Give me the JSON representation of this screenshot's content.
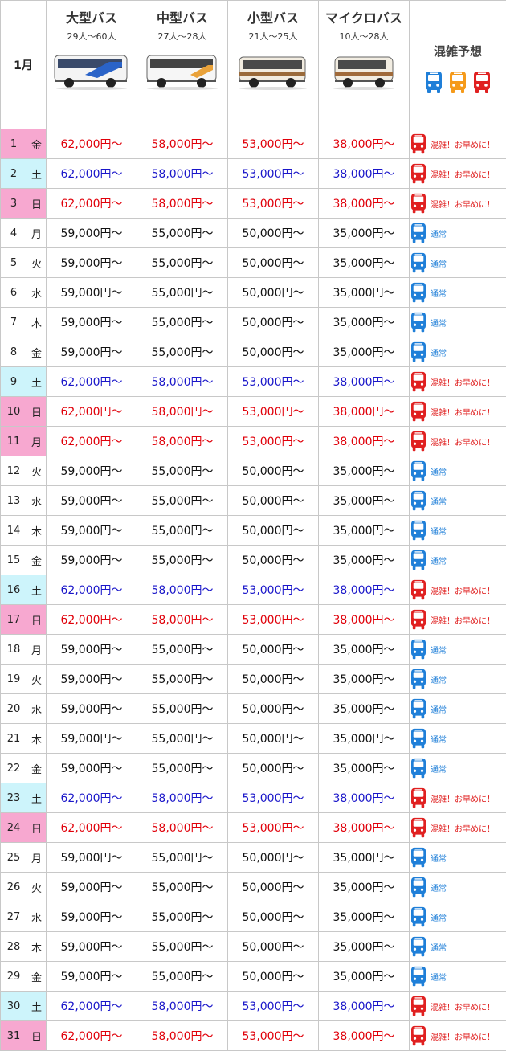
{
  "header": {
    "month": "1月",
    "buses": [
      {
        "name": "大型バス",
        "capacity": "29人～60人"
      },
      {
        "name": "中型バス",
        "capacity": "27人～28人"
      },
      {
        "name": "小型バス",
        "capacity": "21人～25人"
      },
      {
        "name": "マイクロバス",
        "capacity": "10人～28人"
      }
    ],
    "forecast_title": "混雑予想"
  },
  "colors": {
    "red": "#e02020",
    "blue": "#1f7fd8",
    "orange": "#f59a1a",
    "sat_blue": "#1a16c9",
    "sun_pink": "#f7a8d0",
    "sat_cyan": "#cdf4fb"
  },
  "forecast_labels": {
    "busy": "混雑！お早めに！",
    "normal": "通常"
  },
  "prices": {
    "peak": [
      "62,000円～",
      "58,000円～",
      "53,000円～",
      "38,000円～"
    ],
    "normal": [
      "59,000円～",
      "55,000円～",
      "50,000円～",
      "35,000円～"
    ]
  },
  "days": [
    {
      "day": "1",
      "wd": "金",
      "type": "hol"
    },
    {
      "day": "2",
      "wd": "土",
      "type": "sat"
    },
    {
      "day": "3",
      "wd": "日",
      "type": "sun"
    },
    {
      "day": "4",
      "wd": "月",
      "type": "weekday"
    },
    {
      "day": "5",
      "wd": "火",
      "type": "weekday"
    },
    {
      "day": "6",
      "wd": "水",
      "type": "weekday"
    },
    {
      "day": "7",
      "wd": "木",
      "type": "weekday"
    },
    {
      "day": "8",
      "wd": "金",
      "type": "weekday"
    },
    {
      "day": "9",
      "wd": "土",
      "type": "sat"
    },
    {
      "day": "10",
      "wd": "日",
      "type": "sun"
    },
    {
      "day": "11",
      "wd": "月",
      "type": "hol"
    },
    {
      "day": "12",
      "wd": "火",
      "type": "weekday"
    },
    {
      "day": "13",
      "wd": "水",
      "type": "weekday"
    },
    {
      "day": "14",
      "wd": "木",
      "type": "weekday"
    },
    {
      "day": "15",
      "wd": "金",
      "type": "weekday"
    },
    {
      "day": "16",
      "wd": "土",
      "type": "sat"
    },
    {
      "day": "17",
      "wd": "日",
      "type": "sun"
    },
    {
      "day": "18",
      "wd": "月",
      "type": "weekday"
    },
    {
      "day": "19",
      "wd": "火",
      "type": "weekday"
    },
    {
      "day": "20",
      "wd": "水",
      "type": "weekday"
    },
    {
      "day": "21",
      "wd": "木",
      "type": "weekday"
    },
    {
      "day": "22",
      "wd": "金",
      "type": "weekday"
    },
    {
      "day": "23",
      "wd": "土",
      "type": "sat"
    },
    {
      "day": "24",
      "wd": "日",
      "type": "sun"
    },
    {
      "day": "25",
      "wd": "月",
      "type": "weekday"
    },
    {
      "day": "26",
      "wd": "火",
      "type": "weekday"
    },
    {
      "day": "27",
      "wd": "水",
      "type": "weekday"
    },
    {
      "day": "28",
      "wd": "木",
      "type": "weekday"
    },
    {
      "day": "29",
      "wd": "金",
      "type": "weekday"
    },
    {
      "day": "30",
      "wd": "土",
      "type": "sat"
    },
    {
      "day": "31",
      "wd": "日",
      "type": "sun"
    }
  ]
}
